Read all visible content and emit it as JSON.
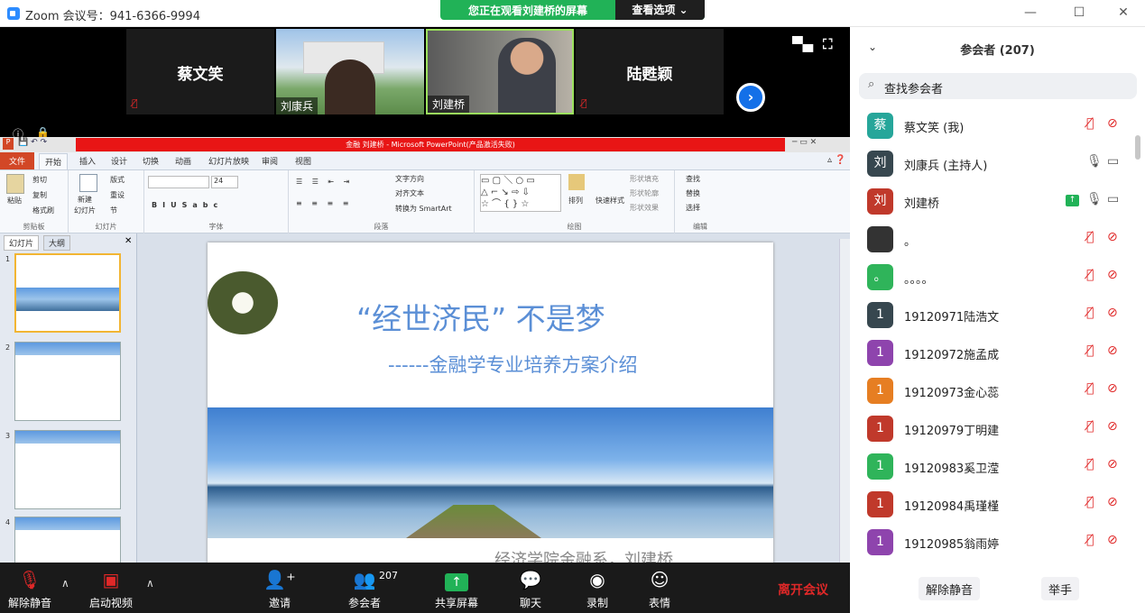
{
  "window": {
    "title": "Zoom 会议号：941-6366-9994",
    "controls": [
      "—",
      "☐",
      "✕"
    ]
  },
  "share_banner": {
    "label": "您正在观看刘建桥的屏幕",
    "options": "查看选项 ⌄"
  },
  "video_tiles": [
    {
      "name": "蔡文笑",
      "muted": true
    },
    {
      "name": "刘康兵",
      "muted": false
    },
    {
      "name": "刘建桥",
      "muted": false
    },
    {
      "name": "陆甦颖",
      "muted": true
    }
  ],
  "ppt": {
    "title": "金融  刘建桥 - Microsoft PowerPoint(产品激活失败)",
    "tabs": [
      "文件",
      "开始",
      "插入",
      "设计",
      "切换",
      "动画",
      "幻灯片放映",
      "审阅",
      "视图"
    ],
    "groups": [
      "剪贴板",
      "幻灯片",
      "字体",
      "段落",
      "绘图",
      "编辑"
    ],
    "clipboard": [
      "粘贴",
      "剪切",
      "复制",
      "格式刷"
    ],
    "slides_group": [
      "新建",
      "幻灯片",
      "版式",
      "重设",
      "节"
    ],
    "font_size": "24",
    "para": [
      "文字方向",
      "对齐文本",
      "转换为 SmartArt"
    ],
    "draw": [
      "排列",
      "快速样式",
      "形状填充",
      "形状轮廓",
      "形状效果"
    ],
    "edit": [
      "查找",
      "替换",
      "选择"
    ],
    "panel_tabs": [
      "幻灯片",
      "大纲"
    ],
    "thumb_numbers": [
      "1",
      "2",
      "3",
      "4"
    ],
    "slide": {
      "title": "“经世济民”  不是梦",
      "subtitle": "------金融学专业培养方案介绍",
      "footer": "经济学院金融系，刘建桥"
    }
  },
  "participants": {
    "header": "参会者 (207)",
    "search_placeholder": "查找参会者",
    "list": [
      {
        "avatar": "蔡",
        "color": "#26a69a",
        "name": "蔡文笑 (我)",
        "mic": "muted",
        "cam": "off"
      },
      {
        "avatar": "刘",
        "color": "#37474f",
        "name": "刘康兵 (主持人)",
        "mic": "on",
        "cam": "on"
      },
      {
        "avatar": "刘",
        "color": "#c0392b",
        "name": "刘建桥",
        "mic": "on",
        "cam": "on",
        "sharing": true
      },
      {
        "avatar": "",
        "color": "#333",
        "name": "。",
        "mic": "muted",
        "cam": "off"
      },
      {
        "avatar": "。",
        "color": "#2fb45a",
        "name": "。。。。",
        "mic": "muted",
        "cam": "off"
      },
      {
        "avatar": "1",
        "color": "#37474f",
        "name": "19120971陆浩文",
        "mic": "muted",
        "cam": "off"
      },
      {
        "avatar": "1",
        "color": "#8e44ad",
        "name": "19120972施孟成",
        "mic": "muted",
        "cam": "off"
      },
      {
        "avatar": "1",
        "color": "#e67e22",
        "name": "19120973金心蕊",
        "mic": "muted",
        "cam": "off"
      },
      {
        "avatar": "1",
        "color": "#c0392b",
        "name": "19120979丁明建",
        "mic": "muted",
        "cam": "off"
      },
      {
        "avatar": "1",
        "color": "#2fb45a",
        "name": "19120983奚卫滢",
        "mic": "muted",
        "cam": "off"
      },
      {
        "avatar": "1",
        "color": "#c0392b",
        "name": "19120984禹瑾槿",
        "mic": "muted",
        "cam": "off"
      },
      {
        "avatar": "1",
        "color": "#8e44ad",
        "name": "19120985翁雨婷",
        "mic": "muted",
        "cam": "off"
      }
    ],
    "buttons": {
      "unmute": "解除静音",
      "raise": "举手"
    }
  },
  "toolbar": {
    "unmute": "解除静音",
    "video": "启动视频",
    "invite": "邀请",
    "participants": "参会者",
    "participants_count": "207",
    "share": "共享屏幕",
    "chat": "聊天",
    "record": "录制",
    "reactions": "表情",
    "leave": "离开会议"
  }
}
